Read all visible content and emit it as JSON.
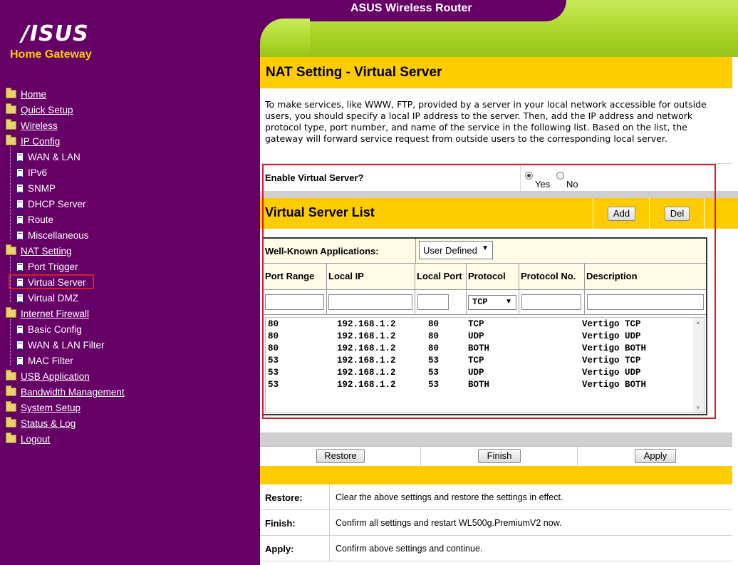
{
  "banner": {
    "title": "ASUS Wireless Router"
  },
  "logo": {
    "brand": "/ISUS",
    "subtitle": "Home Gateway"
  },
  "menu": [
    {
      "label": "Home",
      "type": "folder"
    },
    {
      "label": "Quick Setup",
      "type": "folder"
    },
    {
      "label": "Wireless",
      "type": "folder"
    },
    {
      "label": "IP Config",
      "type": "folder"
    },
    {
      "label": "WAN & LAN",
      "type": "doc"
    },
    {
      "label": "IPv6",
      "type": "doc"
    },
    {
      "label": "SNMP",
      "type": "doc"
    },
    {
      "label": "DHCP Server",
      "type": "doc"
    },
    {
      "label": "Route",
      "type": "doc"
    },
    {
      "label": "Miscellaneous",
      "type": "doc"
    },
    {
      "label": "NAT Setting",
      "type": "folder"
    },
    {
      "label": "Port Trigger",
      "type": "doc"
    },
    {
      "label": "Virtual Server",
      "type": "doc",
      "selected": true
    },
    {
      "label": "Virtual DMZ",
      "type": "doc"
    },
    {
      "label": "Internet Firewall",
      "type": "folder"
    },
    {
      "label": "Basic Config",
      "type": "doc"
    },
    {
      "label": "WAN & LAN Filter",
      "type": "doc"
    },
    {
      "label": "MAC Filter",
      "type": "doc"
    },
    {
      "label": "USB Application",
      "type": "folder"
    },
    {
      "label": "Bandwidth Management",
      "type": "folder"
    },
    {
      "label": "System Setup",
      "type": "folder"
    },
    {
      "label": "Status & Log",
      "type": "folder"
    },
    {
      "label": "Logout",
      "type": "folder"
    }
  ],
  "page": {
    "title": "NAT Setting - Virtual Server",
    "intro": "To make services, like WWW, FTP, provided by a server in your local network accessible for outside users, you should specify a local IP address to the server. Then, add the IP address and network protocol type, port number, and name of the service in the following list. Based on the list, the gateway will forward service request from outside users to the corresponding local server."
  },
  "enable": {
    "label": "Enable Virtual Server?",
    "yes": "Yes",
    "no": "No",
    "selected": "Yes"
  },
  "vs_list": {
    "title": "Virtual Server List",
    "add_label": "Add",
    "del_label": "Del",
    "wk_label": "Well-Known Applications:",
    "wk_value": "User Defined",
    "columns": [
      "Port Range",
      "Local IP",
      "Local Port",
      "Protocol",
      "Protocol No.",
      "Description"
    ],
    "protocol_value": "TCP",
    "rows": [
      {
        "port": "80",
        "ip": "192.168.1.2",
        "lport": "80",
        "proto": "TCP",
        "desc": "Vertigo TCP"
      },
      {
        "port": "80",
        "ip": "192.168.1.2",
        "lport": "80",
        "proto": "UDP",
        "desc": "Vertigo UDP"
      },
      {
        "port": "80",
        "ip": "192.168.1.2",
        "lport": "80",
        "proto": "BOTH",
        "desc": "Vertigo BOTH"
      },
      {
        "port": "53",
        "ip": "192.168.1.2",
        "lport": "53",
        "proto": "TCP",
        "desc": "Vertigo TCP"
      },
      {
        "port": "53",
        "ip": "192.168.1.2",
        "lport": "53",
        "proto": "UDP",
        "desc": "Vertigo UDP"
      },
      {
        "port": "53",
        "ip": "192.168.1.2",
        "lport": "53",
        "proto": "BOTH",
        "desc": "Vertigo BOTH"
      }
    ]
  },
  "actions": {
    "restore_label": "Restore",
    "finish_label": "Finish",
    "apply_label": "Apply"
  },
  "help": [
    {
      "key": "Restore:",
      "text": "Clear the above settings and restore the settings in effect."
    },
    {
      "key": "Finish:",
      "text": "Confirm all settings and restart WL500g.PremiumV2 now."
    },
    {
      "key": "Apply:",
      "text": "Confirm above settings and continue."
    }
  ],
  "colors": {
    "sidebar": "#660066",
    "accent_yellow": "#ffcc00",
    "banner_green": "#a8d426",
    "highlight_red": "#d21f26"
  }
}
